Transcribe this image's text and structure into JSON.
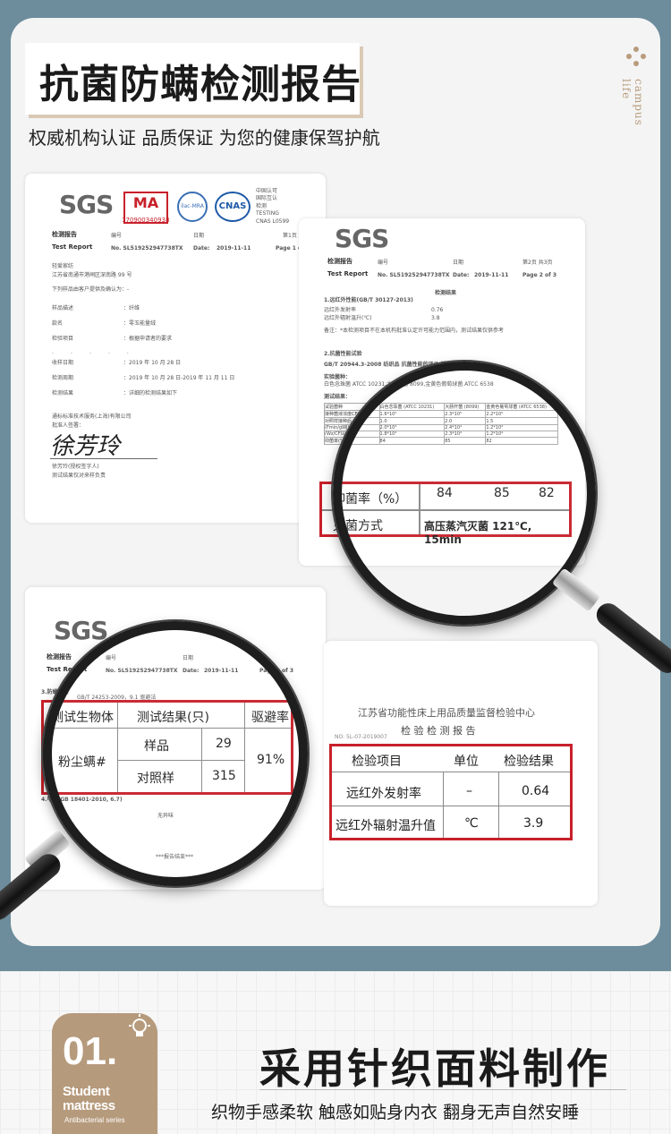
{
  "header": {
    "title": "抗菌防螨检测报告",
    "subtitle": "权威机构认证 品质保证 为您的健康保驾护航",
    "side_text": "campus life"
  },
  "doc1": {
    "logos": [
      "SGS",
      "MA",
      "ilac-MRA",
      "CNAS"
    ],
    "ma_number": "170900340938",
    "cert_lines": [
      "中国认可",
      "国际互认",
      "检测",
      "TESTING",
      "CNAS L0599"
    ],
    "report_cn": "检测报告",
    "report_en": "Test Report",
    "no_label": "编号",
    "no_value": "No. SL519252947738TX",
    "date_cn": "日期",
    "date_label": "Date:",
    "date_value": "2019-11-11",
    "page_cn": "第1页 共",
    "page_en": "Page 1 of",
    "client": "轻爱家纺",
    "address": "江苏省南通市港闸区深南路 99 号",
    "note": "下列样品由客户提供及确认为：-",
    "rows": [
      {
        "k": "样品描述",
        "v": "：纤维"
      },
      {
        "k": "款名",
        "v": "：零玉能量绒"
      },
      {
        "k": "检验项目",
        "v": "：根据申请者的要求"
      },
      {
        "k": "收样日期",
        "v": "：2019 年 10 月 28 日"
      },
      {
        "k": "检测周期",
        "v": "：2019 年 10 月 28 日-2019 年 11 月 11 日"
      },
      {
        "k": "检测结果",
        "v": "：详细的检测结果如下"
      }
    ],
    "company": "通标标准技术服务(上海)有限公司",
    "approver_label": "批准人签署：",
    "signature": "徐芳玲",
    "signer": "徐芳玲(授权签字人)",
    "footer_note": "测试结果仅对来样负责"
  },
  "doc2": {
    "report_cn": "检测报告",
    "report_en": "Test Report",
    "no_label": "编号",
    "no_value": "No. SL519252947738TX",
    "date_cn": "日期",
    "date_label": "Date:",
    "date_value": "2019-11-11",
    "page_cn": "第2页 共3页",
    "page_en": "Page 2 of 3",
    "results_title": "检测结果",
    "section1": "1.远红外性能(GB/T 30127-2013)",
    "s1_rows": [
      {
        "k": "远红外发射率",
        "v": "0.76"
      },
      {
        "k": "远红外辐射温升(℃)",
        "v": "3.8"
      }
    ],
    "note": "备注：*本检测项目不在本机构批准认定许可能力范围内，测试结果仅供参考",
    "section2": "2.抗菌性能试验",
    "std": "GB/T 20944.3-2008 纺织品 抗菌性能的评价 第3部分",
    "sample_label": "实验菌种：",
    "strains": "白色念珠菌 ATCC 10231,大肠杆菌 8099,金黄色葡萄球菌 ATCC 6538",
    "table_title": "测试结果：",
    "mini_rows": [
      [
        "试验菌种",
        "白色念珠菌\n(ATCC 10231)",
        "大肠杆菌\n(8099)",
        "金黄色葡萄球菌\n(ATCC 6538)"
      ],
      [
        "接种菌液浓度CFU/mL)",
        "1.6*10⁵",
        "2.3*10⁵",
        "2.2*10⁵"
      ],
      [
        "对照样接种后",
        "1.0",
        "2.0",
        "1.5"
      ],
      [
        "(Fmin/gWJ)",
        "2.0*10⁴",
        "2.4*10⁴",
        "1.2*10⁴"
      ],
      [
        "(Wz/CFU/ml)",
        "1.8*10⁴",
        "2.3*10⁴",
        "1.2*10⁴"
      ],
      [
        "抑菌率(%)",
        "84",
        "85",
        "82"
      ]
    ],
    "zoom": {
      "row1_label": "抑菌率（%）",
      "v1": "84",
      "v2": "85",
      "v3": "82",
      "row2_label": "灭菌方式",
      "row2_value": "高压蒸汽灭菌 121℃, 15min"
    }
  },
  "doc3": {
    "report_cn": "检测报告",
    "report_en": "Test Report",
    "no_label": "编号",
    "no_value": "No. SL519252947738TX",
    "date_cn": "日期",
    "date_label": "Date:",
    "date_value": "2019-11-11",
    "page_en": "Page 3 of 3",
    "section3": "3.防螨性能",
    "std": "GB/T 24253-2009，9.1 驱避法",
    "std2": "4.甲醛(GB 18401-2010, 6.7)",
    "none_text": "无异味",
    "end_text": "***报告结束***",
    "zoom": {
      "h1": "测试生物体",
      "h2": "测试结果(只)",
      "h3": "驱避率",
      "organism": "粉尘螨#",
      "r1_label": "样品",
      "r1_value": "29",
      "r2_label": "对照样",
      "r2_value": "315",
      "rate": "91%"
    }
  },
  "doc4": {
    "org": "江苏省功能性床上用品质量监督检验中心",
    "title": "检 验 检 测 报 告",
    "code": "NO: 5L-07-2019007",
    "zoom": {
      "h1": "检验项目",
      "h2": "单位",
      "h3": "检验结果",
      "r1_item": "远红外发射率",
      "r1_unit": "–",
      "r1_value": "0.64",
      "r2_item": "远红外辐射温升值",
      "r2_unit": "℃",
      "r2_value": "3.9"
    }
  },
  "footer": {
    "badge_num": "01.",
    "badge_l1": "Student",
    "badge_l2": "mattress",
    "badge_l3": "Antibacterial series",
    "heading": "采用针织面料制作",
    "subheading": "织物手感柔软 触感如贴身内衣 翻身无声自然安睡"
  },
  "colors": {
    "accent": "#b69a7c",
    "frame": "#6d8d9c",
    "highlight": "#c8202a"
  }
}
